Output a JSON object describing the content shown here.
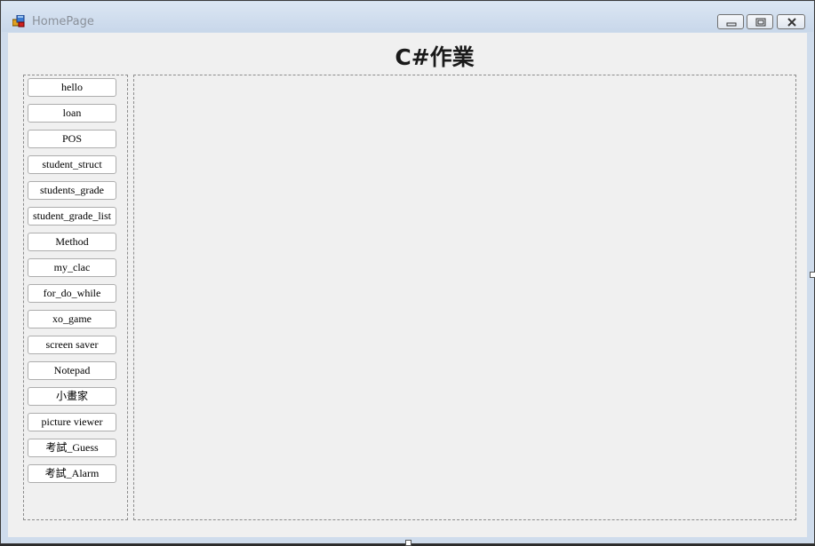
{
  "window": {
    "title": "HomePage"
  },
  "form": {
    "heading": "C#作業"
  },
  "sidebar": {
    "buttons": [
      {
        "label": "hello"
      },
      {
        "label": "loan"
      },
      {
        "label": "POS"
      },
      {
        "label": "student_struct"
      },
      {
        "label": "students_grade"
      },
      {
        "label": "student_grade_list"
      },
      {
        "label": "Method"
      },
      {
        "label": "my_clac"
      },
      {
        "label": "for_do_while"
      },
      {
        "label": "xo_game"
      },
      {
        "label": "screen saver"
      },
      {
        "label": "Notepad"
      },
      {
        "label": "小畫家"
      },
      {
        "label": "picture viewer"
      },
      {
        "label": "考試_Guess"
      },
      {
        "label": "考試_Alarm"
      }
    ]
  },
  "icons": {
    "app": "windows-form-icon",
    "minimize": "minimize-icon",
    "maximize": "maximize-icon",
    "close": "close-icon"
  },
  "colors": {
    "client_background": "#f0f0f0",
    "titlebar": "#cfdcec"
  }
}
